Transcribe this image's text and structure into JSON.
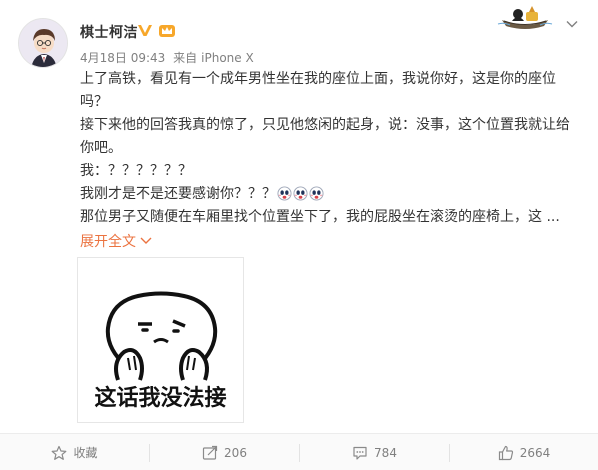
{
  "post": {
    "author": "棋士柯洁",
    "date": "4月18日 09:43",
    "source_prefix": "来自",
    "source": "iPhone X",
    "lines": [
      "上了高铁，看见有一个成年男性坐在我的座位上面，我说你好，这是你的座位吗？",
      "接下来他的回答我真的惊了，只见他悠闲的起身，说：没事，这个位置我就让给你吧。",
      "我：？？？？？？",
      "我刚才是不是还要感谢你？？？",
      "那位男子又随便在车厢里找个位置坐下了，我的屁股坐在滚烫的座椅上，这 ..."
    ],
    "emojis": [
      "shocked-face",
      "shocked-face",
      "shocked-face"
    ],
    "expand_label": "展开全文",
    "image_caption": "这话我没法接"
  },
  "actions": {
    "favorite_label": "收藏",
    "repost_count": "206",
    "comment_count": "784",
    "like_count": "2664"
  },
  "colors": {
    "link": "#eb7340",
    "vip": "#f7a72a",
    "text": "#333333",
    "meta": "#808080"
  }
}
